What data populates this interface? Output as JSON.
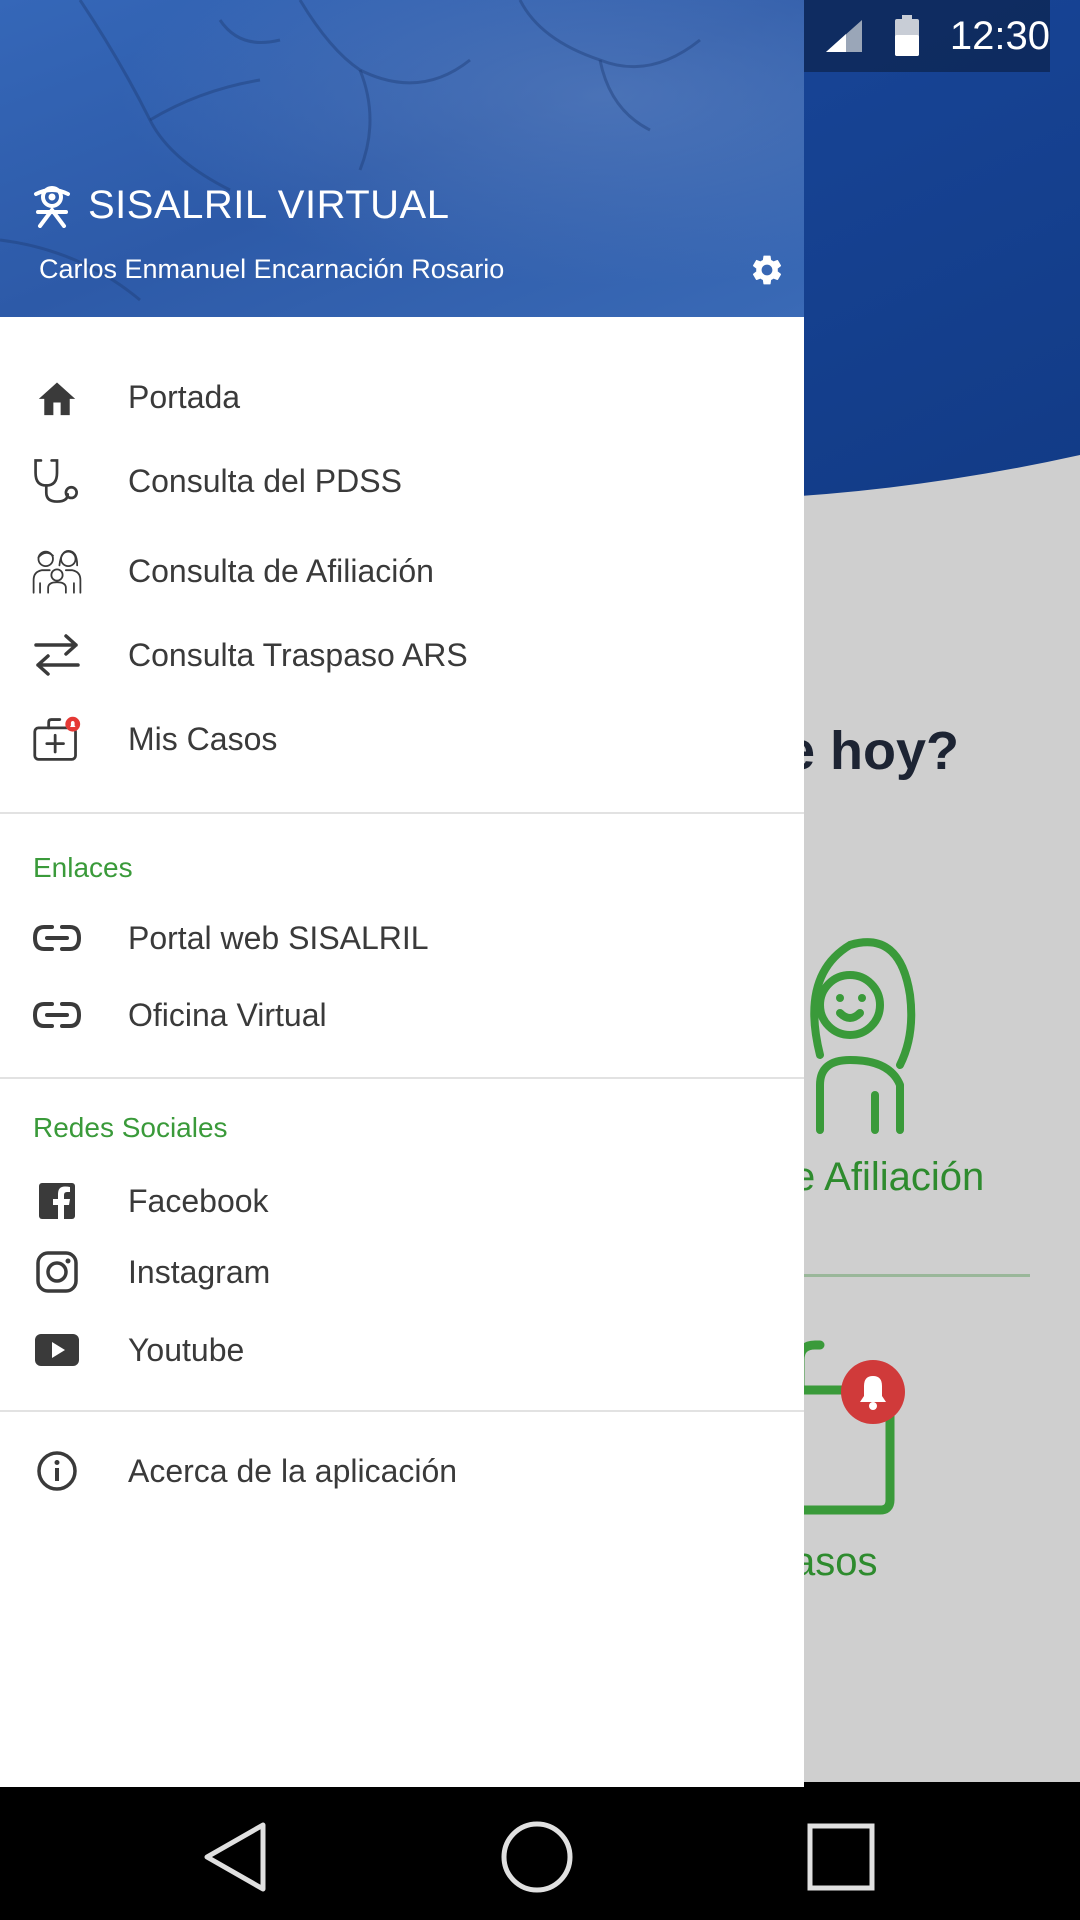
{
  "status_bar": {
    "time": "12:30"
  },
  "drawer": {
    "app_title": "SISALRIL VIRTUAL",
    "user_name": "Carlos Enmanuel Encarnación Rosario",
    "main_items": [
      {
        "label": "Portada",
        "icon": "home-icon"
      },
      {
        "label": "Consulta del PDSS",
        "icon": "stethoscope-icon"
      },
      {
        "label": "Consulta de Afiliación",
        "icon": "family-icon"
      },
      {
        "label": "Consulta Traspaso ARS",
        "icon": "transfer-arrows-icon"
      },
      {
        "label": "Mis Casos",
        "icon": "medical-kit-icon"
      }
    ],
    "links_section": {
      "title": "Enlaces",
      "items": [
        {
          "label": "Portal web SISALRIL",
          "icon": "link-icon"
        },
        {
          "label": "Oficina Virtual",
          "icon": "link-icon"
        }
      ]
    },
    "social_section": {
      "title": "Redes Sociales",
      "items": [
        {
          "label": "Facebook",
          "icon": "facebook-icon"
        },
        {
          "label": "Instagram",
          "icon": "instagram-icon"
        },
        {
          "label": "Youtube",
          "icon": "youtube-icon"
        }
      ]
    },
    "about_item": {
      "label": "Acerca de la aplicación",
      "icon": "info-icon"
    }
  },
  "background_screen": {
    "question_fragment": "le hoy?",
    "card1_label_fragment": "e Afiliación",
    "card2_label_fragment": "asos"
  },
  "colors": {
    "accent_green": "#3a9a3a",
    "header_blue": "#2f5fae",
    "badge_red": "#d03a3a"
  }
}
